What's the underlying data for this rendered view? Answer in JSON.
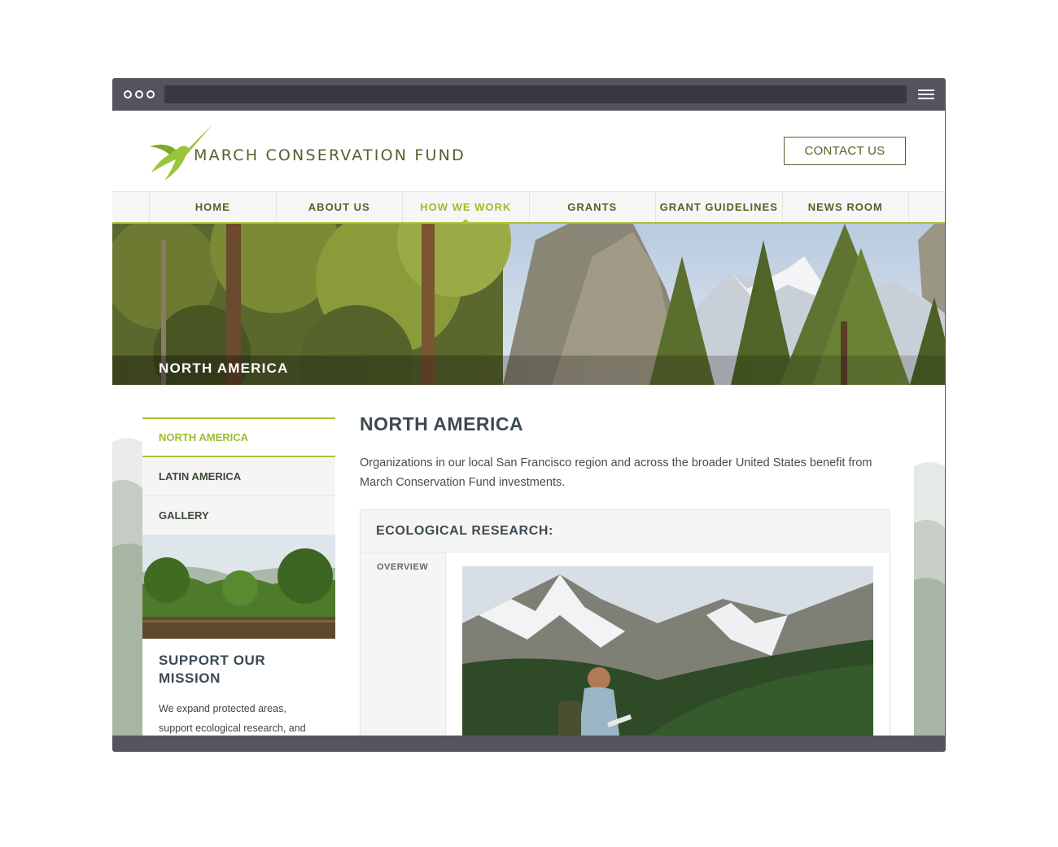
{
  "browser": {
    "menu_icon": "hamburger-icon",
    "dots_icon": "window-dots-icon"
  },
  "header": {
    "logo_text": "MARCH CONSERVATION FUND",
    "logo_icon": "hummingbird-icon",
    "contact_label": "CONTACT US"
  },
  "nav": {
    "items": [
      {
        "label": "HOME"
      },
      {
        "label": "ABOUT US"
      },
      {
        "label": "HOW WE WORK"
      },
      {
        "label": "GRANTS"
      },
      {
        "label": "GRANT GUIDELINES"
      },
      {
        "label": "NEWS ROOM"
      }
    ],
    "active_index": 2
  },
  "hero": {
    "title": "NORTH AMERICA"
  },
  "sidebar": {
    "items": [
      {
        "label": "NORTH AMERICA"
      },
      {
        "label": "LATIN AMERICA"
      },
      {
        "label": "GALLERY"
      }
    ],
    "card": {
      "title": "SUPPORT OUR MISSION",
      "text": "We expand protected areas, support ecological research, and"
    }
  },
  "main": {
    "title": "NORTH AMERICA",
    "intro": "Organizations in our local San Francisco region and across the broader United States benefit from March Conservation Fund investments.",
    "panel": {
      "title": "ECOLOGICAL RESEARCH:",
      "tab": "OVERVIEW"
    }
  },
  "colors": {
    "brand_olive": "#56602b",
    "accent_green": "#a6c532",
    "chrome": "#55535f",
    "heading": "#3d4a52"
  }
}
